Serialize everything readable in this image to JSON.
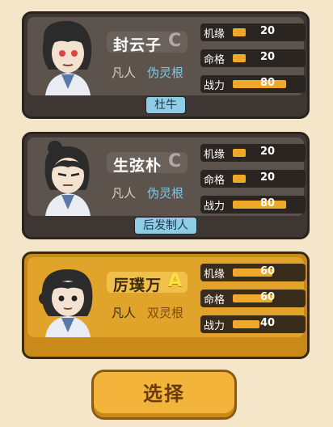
{
  "cards": [
    {
      "name": "封云子",
      "grade": "C",
      "rank": "凡人",
      "root": "伪灵根",
      "stats": [
        {
          "label": "机缘",
          "value": "20",
          "fill": 0.2
        },
        {
          "label": "命格",
          "value": "20",
          "fill": 0.2
        },
        {
          "label": "战力",
          "value": "80",
          "fill": 0.8
        }
      ],
      "tag": "杜牛",
      "selected": false
    },
    {
      "name": "生弦朴",
      "grade": "C",
      "rank": "凡人",
      "root": "伪灵根",
      "stats": [
        {
          "label": "机缘",
          "value": "20",
          "fill": 0.2
        },
        {
          "label": "命格",
          "value": "20",
          "fill": 0.2
        },
        {
          "label": "战力",
          "value": "80",
          "fill": 0.8
        }
      ],
      "tag": "后发制人",
      "selected": false
    },
    {
      "name": "厉璞万",
      "grade": "A",
      "rank": "凡人",
      "root": "双灵根",
      "stats": [
        {
          "label": "机缘",
          "value": "60",
          "fill": 0.6
        },
        {
          "label": "命格",
          "value": "60",
          "fill": 0.6
        },
        {
          "label": "战力",
          "value": "40",
          "fill": 0.4
        }
      ],
      "tag": "",
      "selected": true
    }
  ],
  "select_button": "选择",
  "colors": {
    "accent": "#f2b43a",
    "card_dark": "#3d3632",
    "card_selected": "#e1a42a",
    "bar": "#f0a82a"
  }
}
